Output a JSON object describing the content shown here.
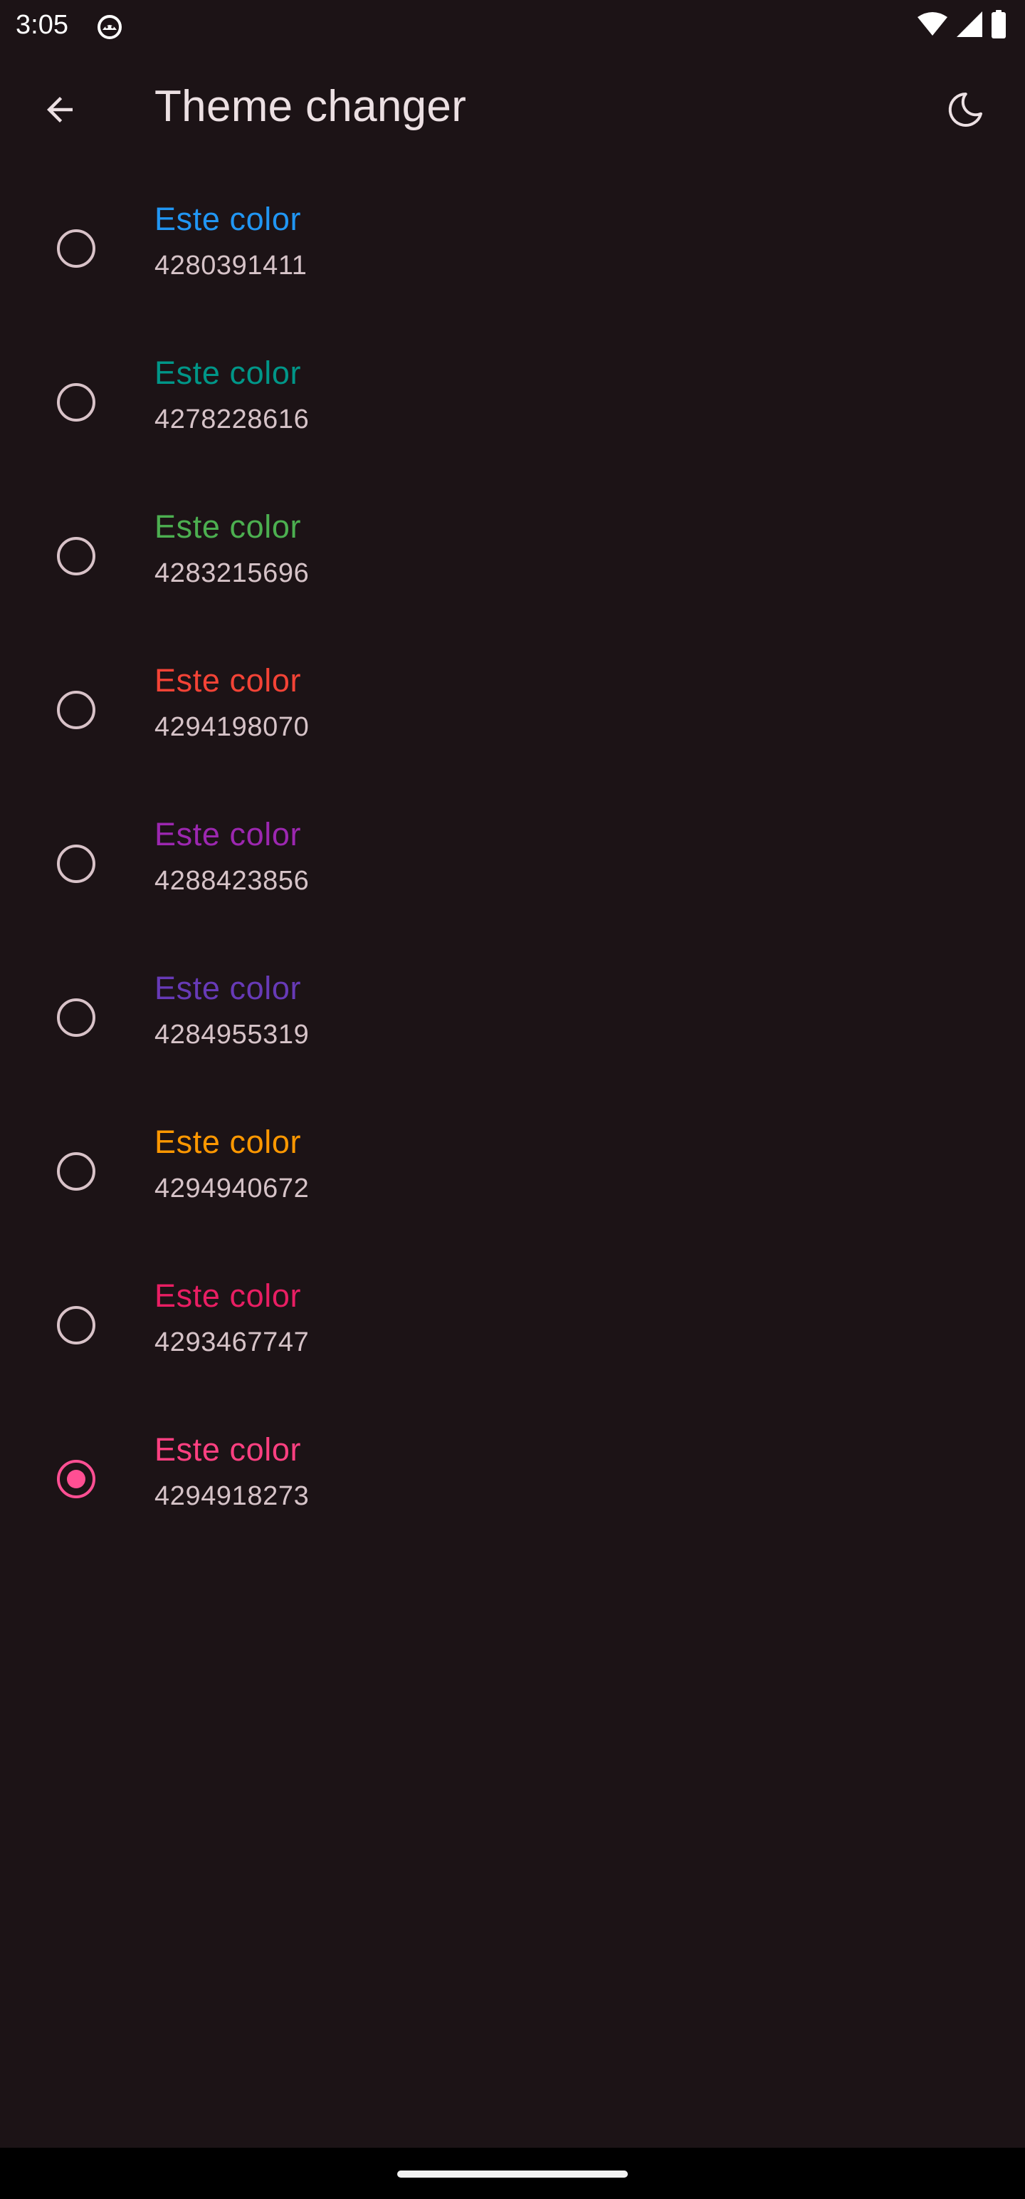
{
  "status_bar": {
    "time": "3:05",
    "app_icon": "android-robot-icon",
    "icons": [
      "wifi-icon",
      "signal-icon",
      "battery-icon"
    ]
  },
  "app_bar": {
    "title": "Theme changer",
    "back_icon": "arrow-back-icon",
    "theme_icon": "moon-icon"
  },
  "colors": [
    {
      "label": "Este color",
      "value": "4280391411",
      "color": "#2196f3",
      "selected": false
    },
    {
      "label": "Este color",
      "value": "4278228616",
      "color": "#009688",
      "selected": false
    },
    {
      "label": "Este color",
      "value": "4283215696",
      "color": "#4caf50",
      "selected": false
    },
    {
      "label": "Este color",
      "value": "4294198070",
      "color": "#f44336",
      "selected": false
    },
    {
      "label": "Este color",
      "value": "4288423856",
      "color": "#9c27b0",
      "selected": false
    },
    {
      "label": "Este color",
      "value": "4284955319",
      "color": "#673ab7",
      "selected": false
    },
    {
      "label": "Este color",
      "value": "4294940672",
      "color": "#ff9800",
      "selected": false
    },
    {
      "label": "Este color",
      "value": "4293467747",
      "color": "#e91e63",
      "selected": false
    },
    {
      "label": "Este color",
      "value": "4294918273",
      "color": "#ff4081",
      "selected": true
    }
  ],
  "theme": {
    "background": "#1c1316",
    "accent": "#ff4f93",
    "on_surface": "#ece0e3",
    "on_surface_variant": "#d6c3c8"
  }
}
